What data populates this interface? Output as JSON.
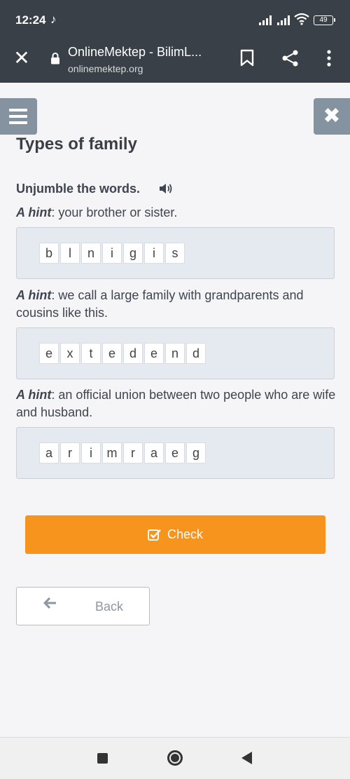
{
  "status": {
    "time": "12:24",
    "battery": "49"
  },
  "browser": {
    "title": "OnlineMektep - BilimL...",
    "url": "onlinemektep.org"
  },
  "page": {
    "title": "Types of family",
    "instruction": "Unjumble the words.",
    "hint_label": "A hint",
    "items": [
      {
        "hint_text": ": your brother or sister.",
        "letters": [
          "b",
          "l",
          "n",
          "i",
          "g",
          "i",
          "s"
        ]
      },
      {
        "hint_text": ": we call a large family with grandparents and cousins like this.",
        "letters": [
          "e",
          "x",
          "t",
          "e",
          "d",
          "e",
          "n",
          "d"
        ]
      },
      {
        "hint_text": ": an official union between two people who are wife and husband.",
        "letters": [
          "a",
          "r",
          "i",
          "m",
          "r",
          "a",
          "e",
          "g"
        ]
      }
    ]
  },
  "buttons": {
    "check": "Check",
    "back": "Back"
  },
  "colors": {
    "accent": "#f7941d",
    "topbar": "#3a4047",
    "side_button": "#8593a0"
  },
  "icons": [
    "close-icon",
    "lock-icon",
    "bookmark-icon",
    "share-icon",
    "more-vert-icon",
    "hamburger-icon",
    "speaker-icon",
    "checkbox-icon",
    "arrow-left-icon"
  ]
}
